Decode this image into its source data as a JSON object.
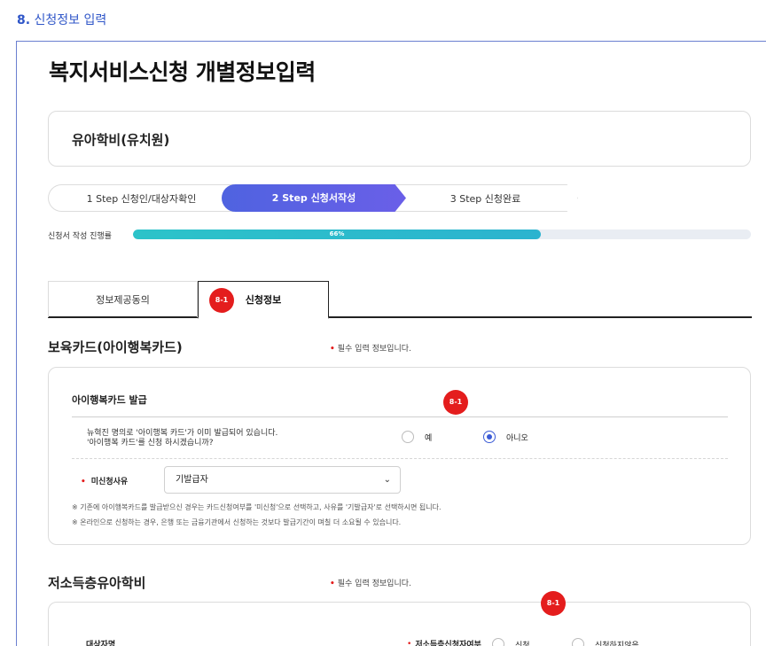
{
  "section": {
    "number": "8.",
    "label": "신청정보 입력"
  },
  "page_title": "복지서비스신청 개별정보입력",
  "service_name": "유아학비(유치원)",
  "steps": [
    {
      "label": "1 Step 신청인/대상자확인"
    },
    {
      "label": "2 Step 신청서작성"
    },
    {
      "label": "3 Step 신청완료"
    }
  ],
  "progress": {
    "label": "신청서 작성 진행률",
    "value_text": "66%",
    "value": 0.66
  },
  "tabs": [
    {
      "label": "정보제공동의"
    },
    {
      "label": "신청정보"
    }
  ],
  "badge_label": "8-1",
  "card_section": {
    "title": "보육카드(아이행복카드)",
    "required_note": "필수 입력 정보입니다.",
    "card_title": "아이행복카드 발급",
    "question_line1": "뉴혁진 명의로 '아이행복 카드'가 이미 발급되어 있습니다.",
    "question_line2": "'아이행복 카드'를 신청 하시겠습니까?",
    "option_yes": "예",
    "option_no": "아니오",
    "reason_label": "미신청사유",
    "reason_value": "기발급자",
    "note1": "※ 기존에 아이행복카드를 발급받으신 경우는 카드신청여부를 '미신청'으로 선택하고, 사유를 '기발급자'로 선택하시면 됩니다.",
    "note2": "※ 온라인으로 신청하는 경우, 은행 또는 금융기관에서 신청하는 것보다 발급기간이 며칠 더 소요될 수 있습니다."
  },
  "low_income_section": {
    "title": "저소득층유아학비",
    "required_note": "필수 입력 정보입니다.",
    "target_label": "대상자명",
    "apply_label": "저소득층신청자여부",
    "option_apply": "신청",
    "option_not_apply": "신청하지않음"
  },
  "colors": {
    "accent": "#4f63e0",
    "progress": "#2cc3c9",
    "badge": "#e41d1d"
  }
}
